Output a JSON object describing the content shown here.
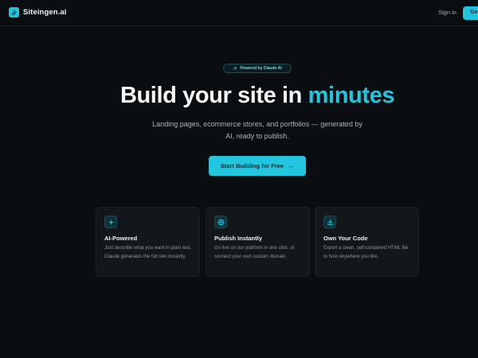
{
  "nav": {
    "brand_name": "Siteingen.ai",
    "signin_label": "Sign in",
    "cta_label": "Get"
  },
  "hero": {
    "badge_text": "Powered by Claude AI",
    "title_main": "Build your site in ",
    "title_accent": "minutes",
    "subtitle": "Landing pages, ecommerce stores, and portfolios — generated by AI, ready to publish.",
    "cta_label": "Start Building for Free",
    "cta_arrow": "→"
  },
  "features": [
    {
      "icon": "sparkle-icon",
      "title": "AI-Powered",
      "description": "Just describe what you want in plain text. Claude generates the full site instantly."
    },
    {
      "icon": "globe-icon",
      "title": "Publish Instantly",
      "description": "Go live on our platform in one click, or connect your own custom domain."
    },
    {
      "icon": "download-icon",
      "title": "Own Your Code",
      "description": "Export a clean, self-contained HTML file to host anywhere you like."
    }
  ],
  "colors": {
    "background": "#0b0e11",
    "accent": "#22c6de",
    "card_background": "#13171b",
    "text_muted": "#aab3bb"
  }
}
